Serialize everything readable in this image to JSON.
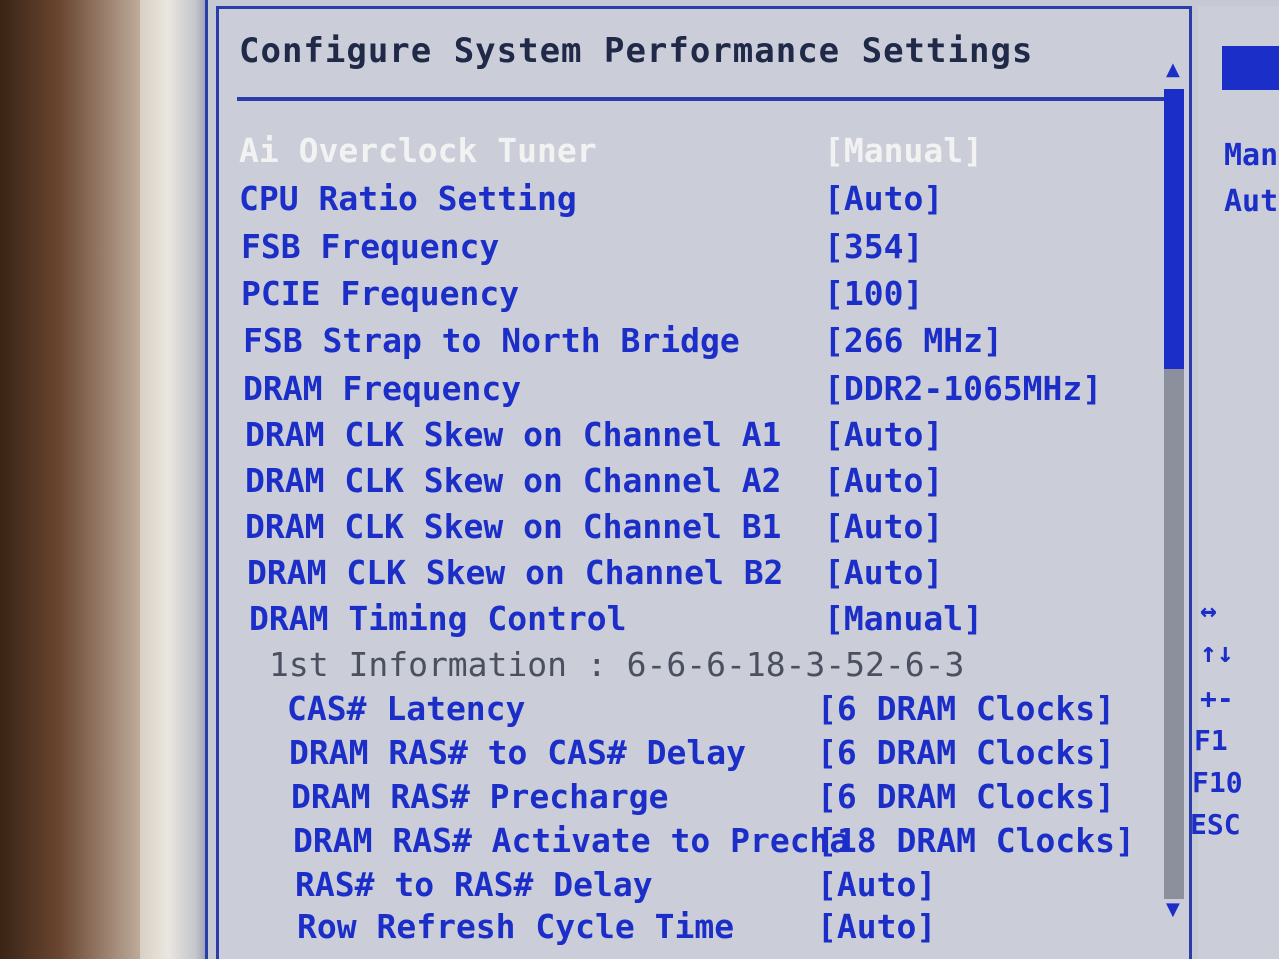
{
  "title": "Configure System Performance Settings",
  "items": [
    {
      "label": "Ai Overclock Tuner",
      "value": "[Manual]",
      "selected": true
    },
    {
      "label": "CPU Ratio Setting",
      "value": "[Auto]"
    },
    {
      "label": "FSB Frequency",
      "value": "[354]"
    },
    {
      "label": "PCIE Frequency",
      "value": "[100]"
    },
    {
      "label": "FSB Strap to North Bridge",
      "value": "[266 MHz]"
    },
    {
      "label": "DRAM Frequency",
      "value": "[DDR2-1065MHz]"
    },
    {
      "label": "DRAM CLK Skew on Channel A1",
      "value": "[Auto]"
    },
    {
      "label": "DRAM CLK Skew on Channel A2",
      "value": "[Auto]"
    },
    {
      "label": "DRAM CLK Skew on Channel B1",
      "value": "[Auto]"
    },
    {
      "label": "DRAM CLK Skew on Channel B2",
      "value": "[Auto]"
    },
    {
      "label": "DRAM Timing Control",
      "value": "[Manual]"
    }
  ],
  "info_line": "1st Information : 6-6-6-18-3-52-6-3",
  "sub_items": [
    {
      "label": "CAS# Latency",
      "value": "[6 DRAM Clocks]"
    },
    {
      "label": "DRAM RAS# to CAS# Delay",
      "value": "[6 DRAM Clocks]"
    },
    {
      "label": "DRAM RAS# Precharge",
      "value": "[6 DRAM Clocks]"
    },
    {
      "label": "DRAM RAS# Activate to Precha",
      "value": "[18 DRAM Clocks]"
    },
    {
      "label": "RAS# to RAS# Delay",
      "value": "[Auto]"
    },
    {
      "label": "Row Refresh Cycle Time",
      "value": "[Auto]"
    }
  ],
  "side_help": [
    "Manu",
    "Auto"
  ],
  "keys": [
    "↔",
    "↑↓",
    "+-",
    "F1",
    "F10",
    "ESC"
  ],
  "icons": {
    "scroll_up": "up-arrow-icon",
    "scroll_down": "down-arrow-icon"
  },
  "colors": {
    "item_text": "#1c2ec8",
    "selected_text": "#f2f2f2",
    "panel_bg": "#cbced8",
    "frame": "#2a3ca8"
  }
}
